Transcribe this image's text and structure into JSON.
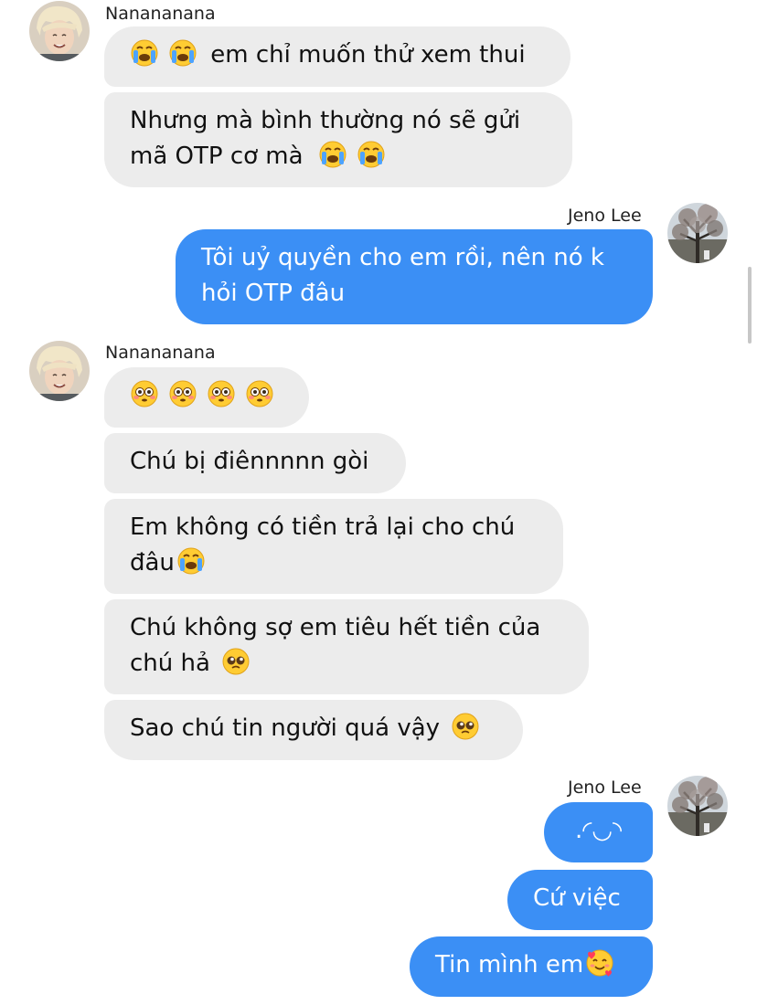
{
  "contacts": {
    "other": {
      "name": "Nanananana"
    },
    "self": {
      "name": "Jeno Lee"
    }
  },
  "icons": {
    "crying": "loudly-crying-face-icon",
    "flushed": "flushed-face-icon",
    "pleading": "pleading-face-icon",
    "hearts": "smiling-face-with-hearts-icon"
  },
  "messages": {
    "m1": {
      "text": "em chỉ muốn thử xem thui"
    },
    "m2": {
      "line1": "Nhưng mà bình thường nó sẽ gửi",
      "line2": "mã OTP cơ mà"
    },
    "m3": {
      "line1": "Tôi uỷ quyền cho em rồi, nên nó k",
      "line2": "hỏi OTP đâu"
    },
    "m5": {
      "text": "Chú bị điênnnnn gòi"
    },
    "m6": {
      "line1": "Em không có tiền trả lại cho chú",
      "line2": "đâu"
    },
    "m7": {
      "line1": "Chú không sợ em tiêu hết tiền của",
      "line2": "chú hả"
    },
    "m8": {
      "text": "Sao chú tin người quá vậy"
    },
    "m9": {
      "text": ".◜◡◝"
    },
    "m10": {
      "text": "Cứ việc"
    },
    "m11": {
      "text": "Tin mình em"
    }
  },
  "colors": {
    "outgoing_bubble": "#3b8ff5",
    "incoming_bubble": "#ececec"
  }
}
